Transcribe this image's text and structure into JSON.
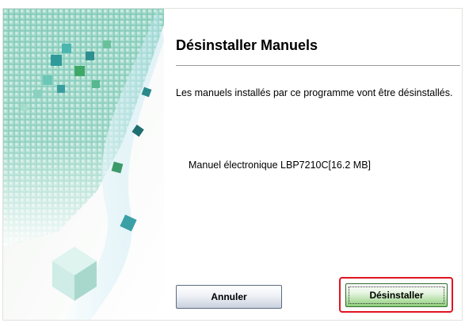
{
  "dialog": {
    "title": "Désinstaller Manuels",
    "description": "Les manuels installés par ce programme vont être désinstallés.",
    "components": [
      "Manuel électronique LBP7210C[16.2 MB]"
    ]
  },
  "buttons": {
    "cancel_label": "Annuler",
    "uninstall_label": "Désinstaller"
  },
  "colors": {
    "highlight_ring": "#e0141f",
    "art_teal": "#2f9a9a",
    "art_green": "#3fa868"
  }
}
